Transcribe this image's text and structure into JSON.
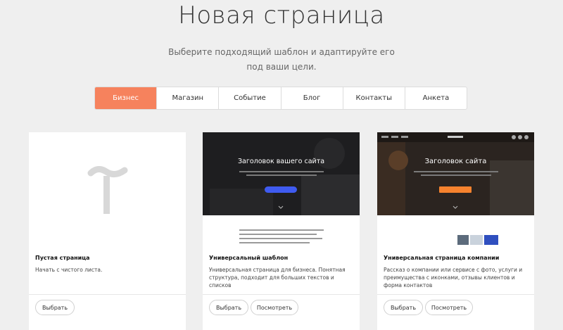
{
  "page": {
    "title": "Новая страница",
    "subtitle": "Выберите подходящий шаблон и адаптируйте его под ваши цели."
  },
  "tabs": [
    {
      "label": "Бизнес",
      "active": true
    },
    {
      "label": "Магазин",
      "active": false
    },
    {
      "label": "Событие",
      "active": false
    },
    {
      "label": "Блог",
      "active": false
    },
    {
      "label": "Контакты",
      "active": false
    },
    {
      "label": "Анкета",
      "active": false
    }
  ],
  "colors": {
    "accent": "#f6825d",
    "background": "#efefef",
    "hero_button_blue": "#3f5bf0",
    "hero_button_orange": "#f6822e"
  },
  "cards": [
    {
      "title": "Пустая страница",
      "description": "Начать с чистого листа.",
      "preview_icon": "tilda-logo-icon",
      "buttons": {
        "select": "Выбрать"
      }
    },
    {
      "title": "Универсальный шаблон",
      "description": "Универсальная страница для бизнеса. Понятная структура, подходит для больших текстов и списков",
      "preview_heading": "Заголовок вашего сайта",
      "buttons": {
        "select": "Выбрать",
        "preview": "Посмотреть"
      }
    },
    {
      "title": "Универсальная страница компании",
      "description": "Рассказ о компании или сервисе с фото, услуги и преимущества с иконками, отзывы клиентов и форма контактов",
      "preview_heading": "Заголовок сайта",
      "buttons": {
        "select": "Выбрать",
        "preview": "Посмотреть"
      }
    }
  ]
}
